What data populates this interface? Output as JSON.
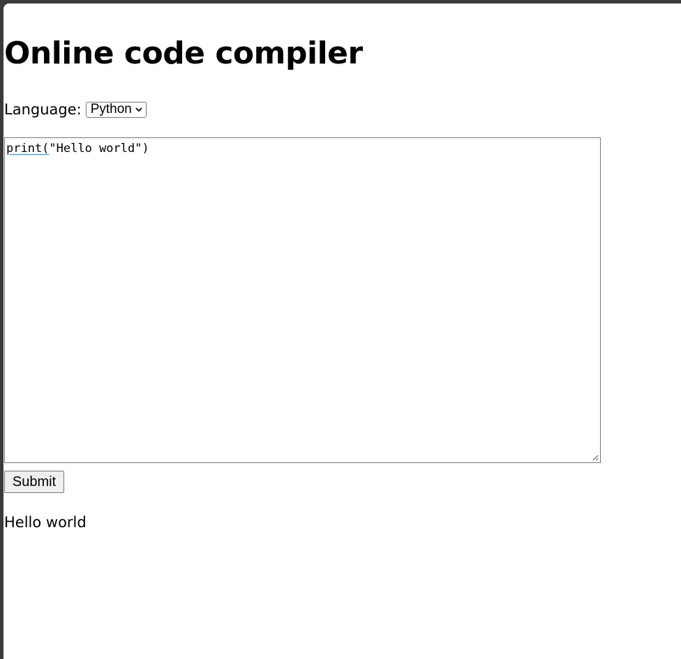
{
  "page": {
    "title": "Online code compiler"
  },
  "language": {
    "label": "Language:",
    "selected": "Python"
  },
  "editor": {
    "code_keyword": "print(",
    "code_rest": "\"Hello world\")"
  },
  "submit": {
    "label": "Submit"
  },
  "output": {
    "text": "Hello world"
  },
  "icons": {
    "dropdown": "chevron-down-icon",
    "resize": "resize-grip-icon"
  }
}
